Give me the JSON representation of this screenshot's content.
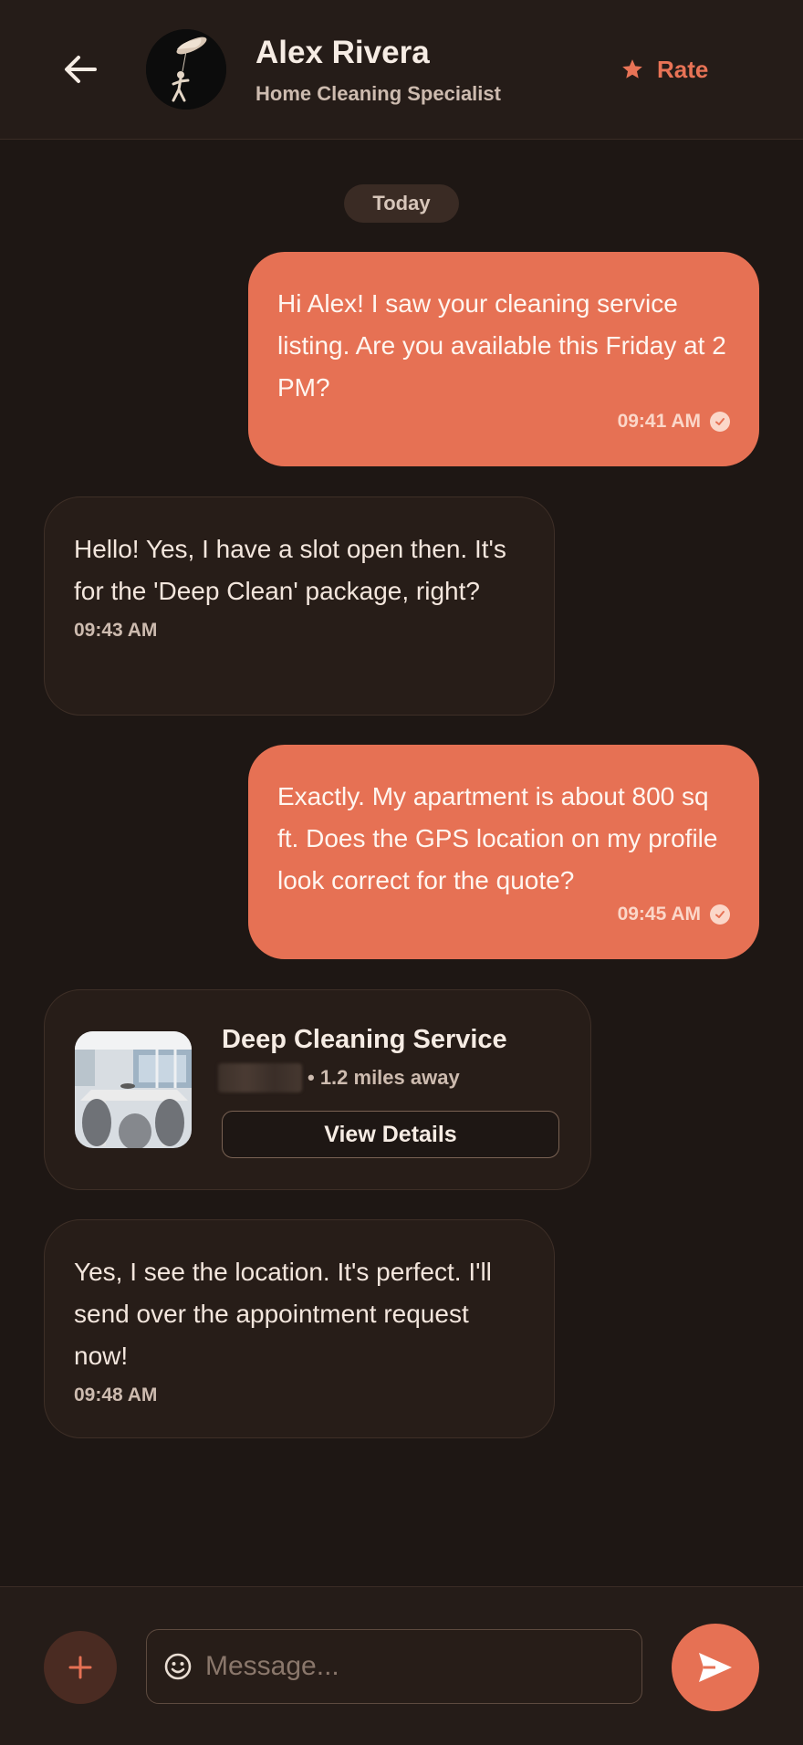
{
  "header": {
    "contact_name": "Alex Rivera",
    "contact_role": "Home Cleaning Specialist",
    "rate_label": "Rate",
    "icons": {
      "back": "arrow-left-icon",
      "rate": "star-icon"
    }
  },
  "date_separator": "Today",
  "messages": [
    {
      "direction": "outgoing",
      "text": "Hi Alex! I saw your cleaning service listing. Are you available this Friday at 2 PM?",
      "time": "09:41 AM",
      "status": "read"
    },
    {
      "direction": "incoming",
      "text": "Hello! Yes, I have a slot open then. It's for the 'Deep Clean' package, right?",
      "time": "09:43 AM"
    },
    {
      "direction": "outgoing",
      "text": "Exactly. My apartment is about 800 sq ft. Does the GPS location on my profile look correct for the quote?",
      "time": "09:45 AM",
      "status": "read"
    },
    {
      "direction": "incoming",
      "text": "Yes, I see the location. It's perfect. I'll send over the appointment request now!",
      "time": "09:48 AM"
    }
  ],
  "service_card": {
    "title": "Deep Cleaning Service",
    "distance": "• 1.2 miles away",
    "button_label": "View Details"
  },
  "composer": {
    "placeholder": "Message...",
    "value": ""
  },
  "colors": {
    "background": "#1e1714",
    "accent": "#e67154",
    "incoming_bubble": "#271d18"
  }
}
